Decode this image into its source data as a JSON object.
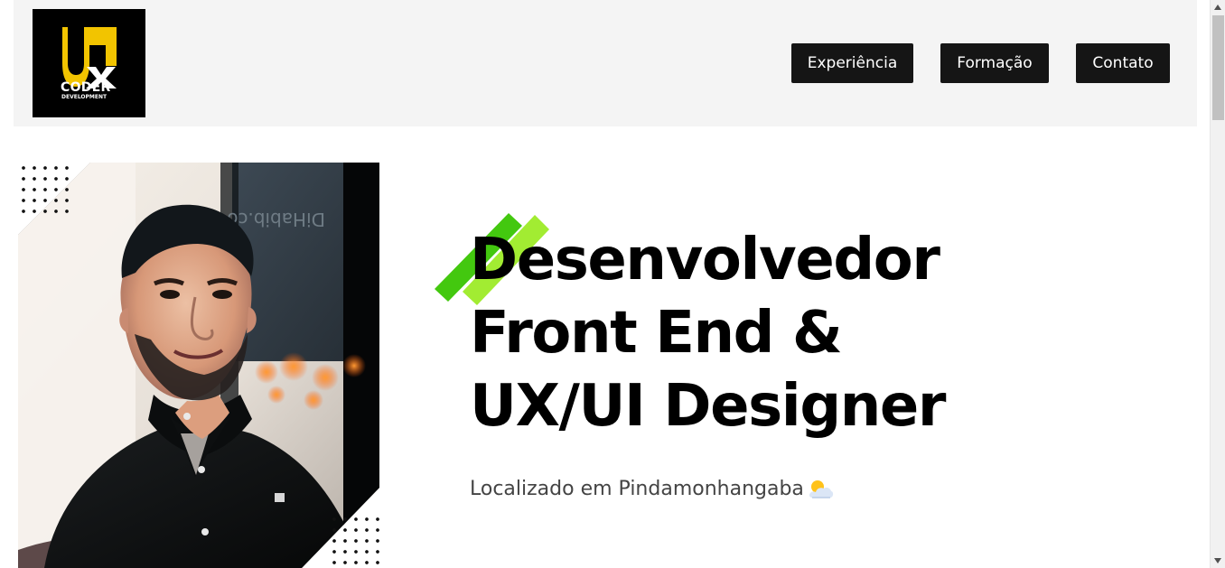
{
  "header": {
    "logo": {
      "main_text": "CODER",
      "sub_text": "DEVELOPMENT",
      "accent_color": "#f2c400",
      "background_color": "#000000"
    },
    "nav": [
      {
        "label": "Experiência"
      },
      {
        "label": "Formação"
      },
      {
        "label": "Contato"
      }
    ]
  },
  "hero": {
    "title_lines": [
      "Desenvolvedor",
      "Front End &",
      "UX/UI Designer"
    ],
    "location": "Localizado em Pindamonhangaba",
    "location_icon": "sun-behind-cloud-icon",
    "accent_colors": [
      "#43c80f",
      "#a2ec32"
    ]
  },
  "colors": {
    "header_background": "#f4f4f4",
    "button_background": "#151515",
    "button_text": "#ffffff",
    "title_text": "#000000",
    "location_text": "#444444"
  }
}
